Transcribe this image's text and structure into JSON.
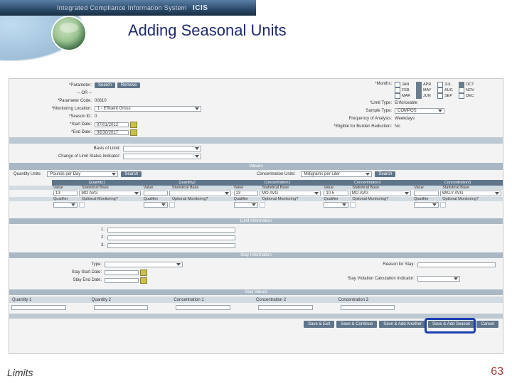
{
  "header": {
    "system_name_light": "Integrated ",
    "system_name_accent": "Compliance Information System",
    "system_abbrev": "ICIS"
  },
  "title": "Adding Seasonal Units",
  "footer": {
    "left": "Limits",
    "page": "63"
  },
  "top_left": {
    "parameter_label": "Parameter:",
    "search_btn": "Search",
    "remove_btn": "Remove",
    "or_label": "-- OR --",
    "param_code_label": "Parameter Code:",
    "param_code_value": "00610",
    "mon_loc_label": "Monitoring Location:",
    "mon_loc_value": "1 - Effluent Gross",
    "season_id_label": "Season ID:",
    "season_id_value": "0",
    "start_date_label": "Start Date:",
    "start_date_value": "07/01/2012",
    "end_date_label": "End Date:",
    "end_date_value": "06/30/2017"
  },
  "top_right": {
    "months_label": "Months:",
    "months": {
      "JAN": false,
      "APR": true,
      "JUL": false,
      "OCT": true,
      "FEB": false,
      "MAY": true,
      "AUG": false,
      "NOV": false,
      "MAR": false,
      "JUN": true,
      "SEP": false,
      "DEC": false
    },
    "limit_type_label": "Limit Type:",
    "limit_type_value": "Enforceable",
    "sample_type_label": "Sample Type:",
    "sample_type_value": "COMPOS",
    "freq_label": "Frequency of Analysis:",
    "freq_value": "Weekdays",
    "burden_label": "Eligible for Burden Reduction:",
    "burden_value": "No"
  },
  "mid": {
    "basis_label": "Basis of Limit:",
    "change_ind_label": "Change of Limit Status Indicator:"
  },
  "values": {
    "header": "Values",
    "qty_units_label": "Quantity Units:",
    "qty_units_value": "Pounds per Day",
    "conc_units_label": "Concentration Units:",
    "conc_units_value": "Milligrams per Liter",
    "search_btn": "Search",
    "cols": [
      "Quantity1",
      "Quantity2",
      "Concentration1",
      "Concentration2",
      "Concentration3"
    ],
    "row_heads": {
      "value": "Value",
      "stat": "Statistical Base",
      "qual": "Qualifier",
      "optmon": "Optional Monitoring?"
    },
    "cells": {
      "q1": {
        "value": "13",
        "stat": "MO AVG"
      },
      "q2": {
        "value": "",
        "stat": ""
      },
      "c1": {
        "value": "13",
        "stat": "MO AVG"
      },
      "c2": {
        "value": "10.5",
        "stat": "MO AVG"
      },
      "c3": {
        "value": "",
        "stat": "WKLY AVG"
      }
    }
  },
  "limit_info": {
    "header": "Limit Information",
    "lines": [
      "1:",
      "2:",
      "3:"
    ]
  },
  "stay_info": {
    "header": "Stay Information",
    "type_label": "Type:",
    "start_label": "Stay Start Date:",
    "end_label": "Stay End Date:",
    "reason_label": "Reason for Stay:",
    "viol_label": "Stay Violation Calculation Indicator:"
  },
  "stay_values": {
    "header": "Stay Values",
    "cols": [
      "Quantity 1",
      "Quantity 2",
      "Concentration 1",
      "Concentration 2",
      "Concentration 3",
      ""
    ]
  },
  "actions": {
    "save_exit": "Save & Exit",
    "save_continue": "Save & Continue",
    "save_add_another": "Save & Add Another",
    "save_add_season": "Save & Add Season",
    "cancel": "Cancel"
  }
}
